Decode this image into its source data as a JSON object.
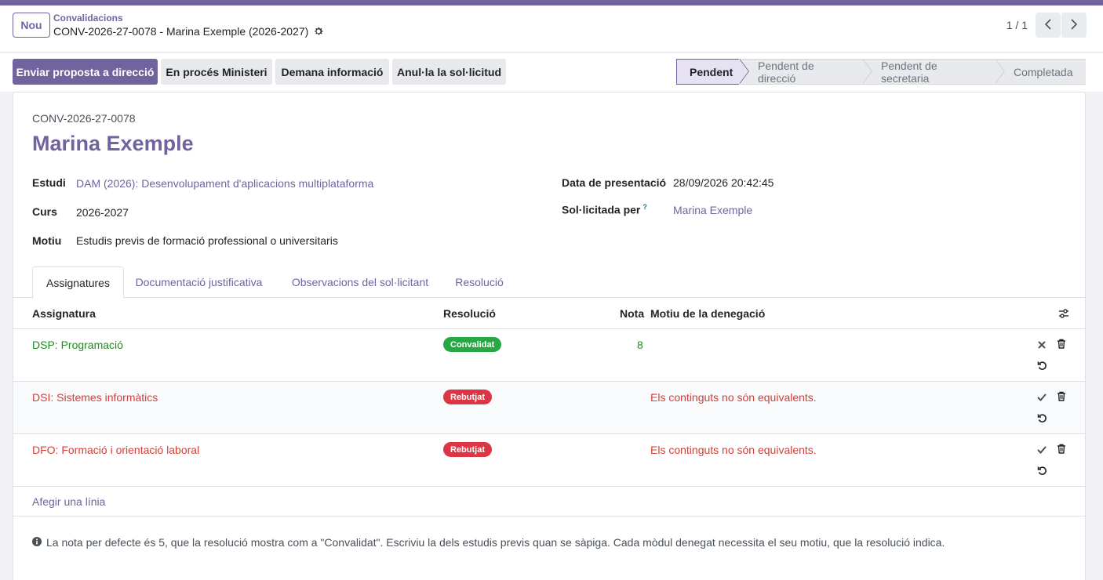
{
  "header": {
    "new_label": "Nou",
    "breadcrumb": "Convalidacions",
    "record_name": "CONV-2026-27-0078 - Marina Exemple (2026-2027)",
    "pager": "1 / 1"
  },
  "actions": {
    "send": "Enviar proposta a direcció",
    "ministry": "En procés Ministeri",
    "request_info": "Demana informació",
    "cancel": "Anul·la la sol·licitud"
  },
  "status": {
    "stages": [
      "Pendent",
      "Pendent de direcció",
      "Pendent de secretaria",
      "Completada"
    ],
    "active": "Pendent"
  },
  "form": {
    "reference": "CONV-2026-27-0078",
    "title": "Marina Exemple",
    "fields": {
      "estudi_label": "Estudi",
      "estudi_value": "DAM (2026): Desenvolupament d'aplicacions multiplataforma",
      "curs_label": "Curs",
      "curs_value": "2026-2027",
      "motiu_label": "Motiu",
      "motiu_value": "Estudis previs de formació professional o universitaris",
      "data_label": "Data de presentació",
      "data_value": "28/09/2026 20:42:45",
      "sollicitada_label": "Sol·licitada per",
      "sollicitada_help": "?",
      "sollicitada_value": "Marina Exemple"
    }
  },
  "tabs": [
    "Assignatures",
    "Documentació justificativa",
    "Observacions del sol·licitant",
    "Resolució"
  ],
  "table": {
    "headers": {
      "assignatura": "Assignatura",
      "resolucio": "Resolució",
      "nota": "Nota",
      "motiu": "Motiu de la denegació"
    },
    "rows": [
      {
        "assignatura": "DSP: Programació",
        "resolucio": "Convalidat",
        "nota": "8",
        "motiu": ""
      },
      {
        "assignatura": "DSI: Sistemes informàtics",
        "resolucio": "Rebutjat",
        "nota": "",
        "motiu": "Els continguts no són equivalents."
      },
      {
        "assignatura": "DFO: Formació i orientació laboral",
        "resolucio": "Rebutjat",
        "nota": "",
        "motiu": "Els continguts no són equivalents."
      }
    ],
    "add_line": "Afegir una línia"
  },
  "note": "La nota per defecte és 5, que la resolució mostra com a \"Convalidat\". Escriviu la dels estudis previs quan se sàpiga. Cada mòdul denegat necessita el seu motiu, que la resolució indica.",
  "colors": {
    "brand": "#71639e",
    "accepted": "#28a745",
    "rejected": "#dc3545"
  }
}
